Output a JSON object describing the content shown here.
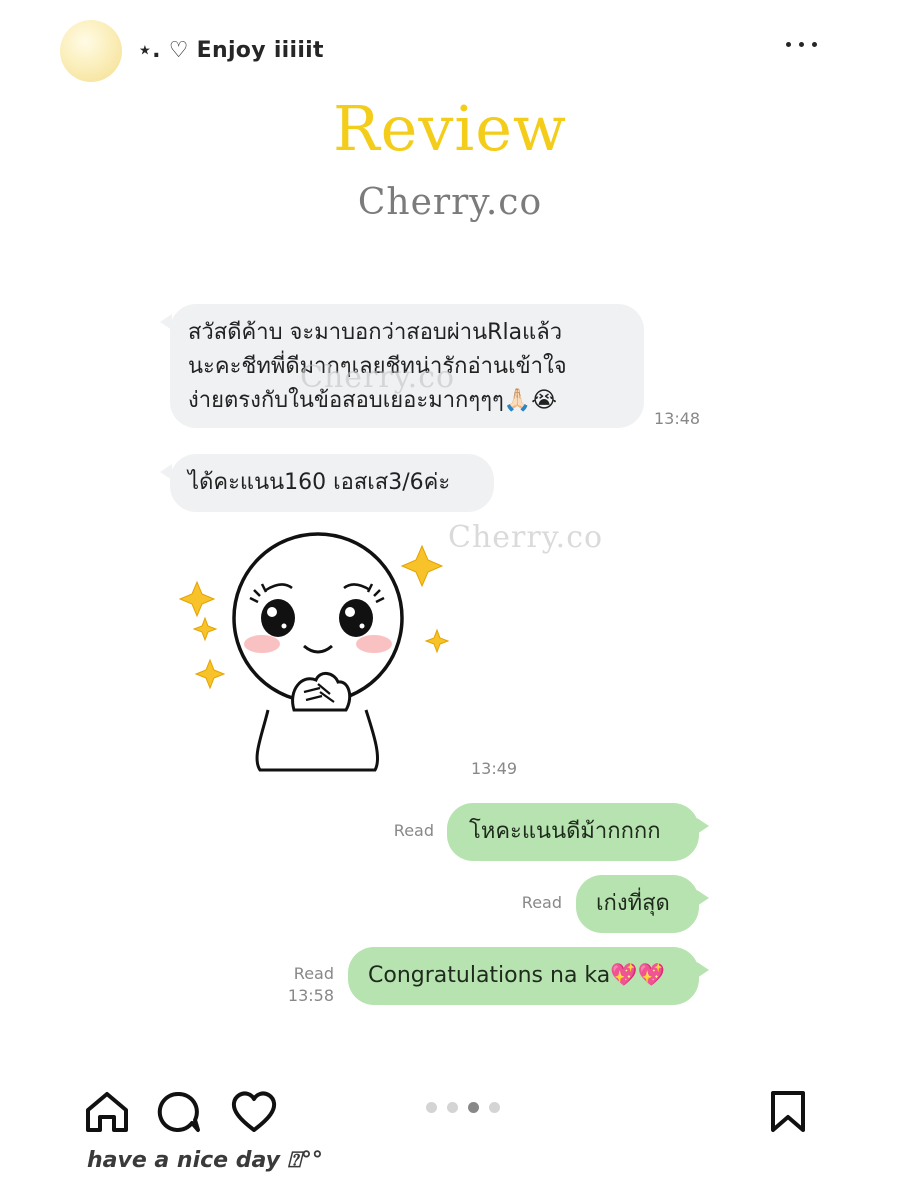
{
  "post": {
    "username": "⋆. ♡ Enjoy iiiiit",
    "title": "Review",
    "brand": "Cherry.co",
    "watermark": "Cherry.co",
    "caption": "have a nice day ⍰°°"
  },
  "chat": {
    "incoming": [
      {
        "lines": [
          "สวัสดีค้าบ จะมาบอกว่าสอบผ่านRlaแล้ว",
          "นะคะชีทพี่ดีมากๆเลยชีทน่ารักอ่านเข้าใจ",
          "ง่ายตรงกับในข้อสอบเยอะมากๆๆๆ🙏🏻😭"
        ],
        "time": "13:48"
      },
      {
        "lines": [
          "ได้คะแนน160 เอสเส3/6ค่ะ"
        ],
        "time": ""
      }
    ],
    "sticker_time": "13:49",
    "outgoing": [
      {
        "text": "โหคะแนนดีม้ากกกก",
        "status": "Read",
        "time": ""
      },
      {
        "text": "เก่งที่สุด",
        "status": "Read",
        "time": ""
      },
      {
        "text": "Congratulations na ka💖💖",
        "status": "Read",
        "time": "13:58"
      }
    ]
  },
  "carousel": {
    "count": 4,
    "active_index": 2
  },
  "icons": {
    "home": "home-icon",
    "comment": "comment-icon",
    "like": "heart-icon",
    "save": "bookmark-icon",
    "more": "more-dots-icon",
    "sticker": "smiling-character-sticker"
  },
  "colors": {
    "title": "#f4cd1a",
    "incoming_bubble": "#eff1f3",
    "outgoing_bubble": "#b7e3b0",
    "sparkle": "#f7c22a"
  }
}
